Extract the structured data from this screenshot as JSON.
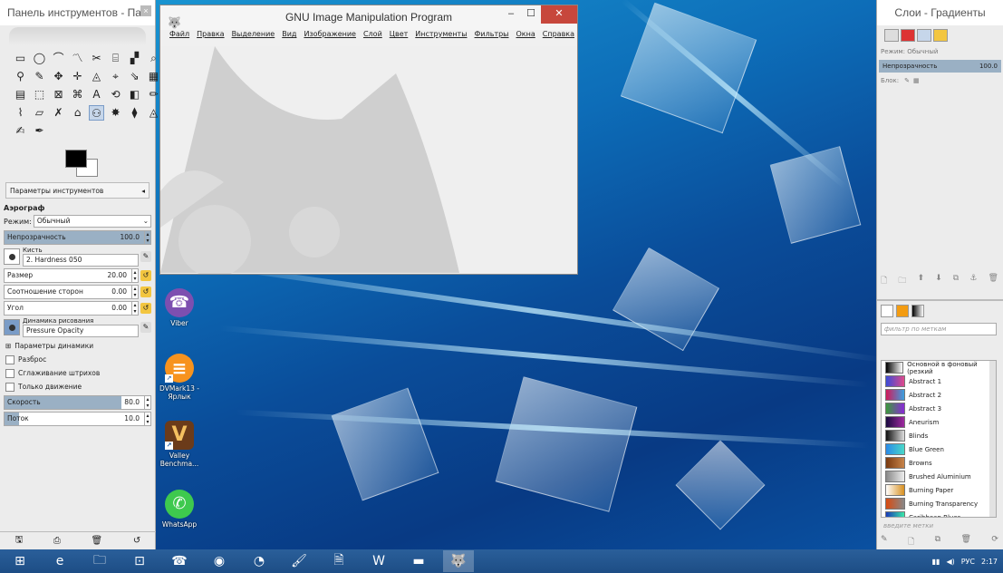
{
  "toolbox": {
    "title": "Панель инструментов - Па...",
    "close_label": "×",
    "tools": [
      "▭",
      "◯",
      "⌒",
      "〽",
      "✂",
      "⌸",
      "▞",
      "⌕",
      "⚲",
      "✎",
      "✥",
      "✛",
      "◬",
      "⌖",
      "⇘",
      "▦",
      "▤",
      "⬚",
      "⊠",
      "⌘",
      "A",
      "⟲",
      "◧",
      "✏",
      "⌇",
      "▱",
      "✗",
      "⌂",
      "⚇",
      "✸",
      "⧫",
      "◬",
      "✍",
      "✒"
    ],
    "tool_options_tab": "Параметры инструментов",
    "tool_name": "Аэрограф",
    "mode_label": "Режим:",
    "mode_value": "Обычный",
    "opacity_label": "Непрозрачность",
    "opacity_value": "100.0",
    "brush_label": "Кисть",
    "brush_value": "2. Hardness 050",
    "size_label": "Размер",
    "size_value": "20.00",
    "aspect_label": "Соотношение сторон",
    "aspect_value": "0.00",
    "angle_label": "Угол",
    "angle_value": "0.00",
    "dynamics_label": "Динамика рисования",
    "dynamics_value": "Pressure Opacity",
    "dynamics_params": "Параметры динамики",
    "scatter_label": "Разброс",
    "smooth_label": "Сглаживание штрихов",
    "motion_label": "Только движение",
    "rate_label": "Скорость",
    "rate_value": "80.0",
    "flow_label": "Поток",
    "flow_value": "10.0",
    "opacity_fraction": 1.0,
    "size_fraction": 0.0,
    "rate_fraction": 0.8,
    "flow_fraction": 0.1
  },
  "gimp": {
    "title": "GNU Image Manipulation Program",
    "menu": [
      "Файл",
      "Правка",
      "Выделение",
      "Вид",
      "Изображение",
      "Слой",
      "Цвет",
      "Инструменты",
      "Фильтры",
      "Окна",
      "Справка"
    ],
    "minimize": "–",
    "maximize": "☐",
    "close": "✕"
  },
  "desktop_icons": [
    {
      "label": "Viber",
      "color": "#7d4fb0",
      "glyph": "☎"
    },
    {
      "label": "DVMark13 - Ярлык",
      "color": "#f7931e",
      "glyph": "≡"
    },
    {
      "label": "Valley Benchma...",
      "color": "#6b3b1a",
      "glyph": "V"
    },
    {
      "label": "WhatsApp",
      "color": "#3ec94e",
      "glyph": "✆"
    }
  ],
  "layers": {
    "title": "Слои - Градиенты",
    "mode_label": "Режим: Обычный",
    "opacity_label": "Непрозрачность",
    "opacity_value": "100.0",
    "lock_label": "Блок:",
    "filter_placeholder": "фильтр по меткам",
    "tag_placeholder": "введите метки"
  },
  "gradients": [
    {
      "name": "Основной в фоновый (резкий",
      "c1": "#000000",
      "c2": "#ffffff"
    },
    {
      "name": "Abstract 1",
      "c1": "#3b4bd8",
      "c2": "#e04a8a"
    },
    {
      "name": "Abstract 2",
      "c1": "#d21a5a",
      "c2": "#3aa0e0"
    },
    {
      "name": "Abstract 3",
      "c1": "#3b9a3b",
      "c2": "#8a2ad8"
    },
    {
      "name": "Aneurism",
      "c1": "#1a0a40",
      "c2": "#a02aa0"
    },
    {
      "name": "Blinds",
      "c1": "#111111",
      "c2": "#dddddd"
    },
    {
      "name": "Blue Green",
      "c1": "#2a8ae8",
      "c2": "#4ad8c8"
    },
    {
      "name": "Browns",
      "c1": "#7a3a10",
      "c2": "#c8844a"
    },
    {
      "name": "Brushed Aluminium",
      "c1": "#888888",
      "c2": "#eeeeee"
    },
    {
      "name": "Burning Paper",
      "c1": "#ffffff",
      "c2": "#d89020"
    },
    {
      "name": "Burning Transparency",
      "c1": "#d84a10",
      "c2": "#888888"
    },
    {
      "name": "Caribbean Blues",
      "c1": "#1a3ab8",
      "c2": "#3ae8a8"
    }
  ],
  "taskbar": {
    "items": [
      "⊞",
      "e",
      "🗀",
      "⊡",
      "☎",
      "◉",
      "◔",
      "🖌",
      "🗎",
      "W",
      "▬",
      "🐺"
    ],
    "tray_lang": "РУС",
    "clock": "2:17"
  }
}
